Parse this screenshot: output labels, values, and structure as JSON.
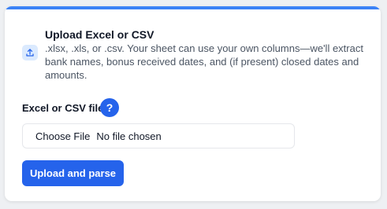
{
  "colors": {
    "accent": "#3b82f6",
    "primary": "#2563eb",
    "icon_bg": "#dbeafe"
  },
  "header": {
    "icon": "upload-icon",
    "title": "Upload Excel or CSV",
    "description": ".xlsx, .xls, or .csv. Your sheet can use your own columns—we'll extract bank names, bonus received dates, and (if present) closed dates and amounts."
  },
  "file_field": {
    "label": "Excel or CSV file",
    "help_label": "?",
    "choose_label": "Choose File",
    "status": "No file chosen"
  },
  "actions": {
    "submit_label": "Upload and parse"
  }
}
